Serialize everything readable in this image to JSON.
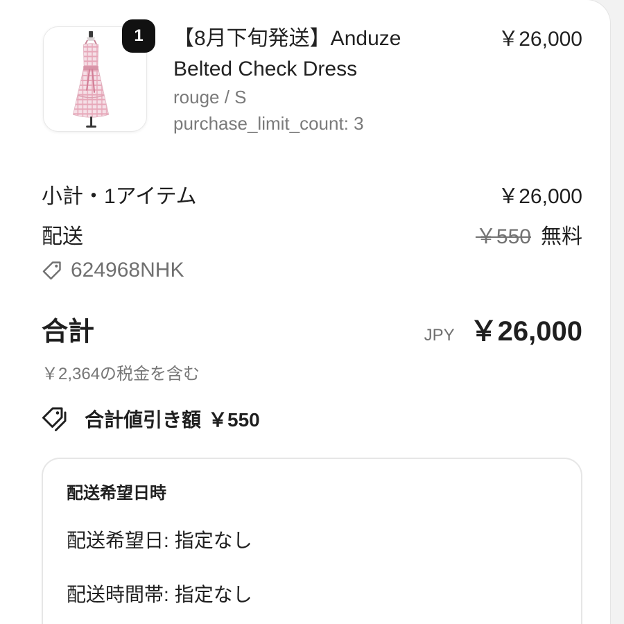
{
  "order_summary": {
    "line_item": {
      "quantity_badge": "1",
      "title": "【8月下旬発送】Anduze Belted Check Dress",
      "variant": "rouge / S",
      "property": "purchase_limit_count: 3",
      "price": "￥26,000"
    },
    "subtotal": {
      "label": "小計・1アイテム",
      "value": "￥26,000"
    },
    "shipping": {
      "label": "配送",
      "original_price": "￥550",
      "value": "無料"
    },
    "discount_code": {
      "icon": "tag-icon",
      "code": "624968NHK"
    },
    "total": {
      "label": "合計",
      "currency": "JPY",
      "value": "￥26,000"
    },
    "tax_note": "￥2,364の税金を含む",
    "total_savings": {
      "icon": "tags-icon",
      "label": "合計値引き額",
      "value": "￥550"
    }
  },
  "delivery_preferences": {
    "heading": "配送希望日時",
    "date": {
      "label": "配送希望日:",
      "value": "指定なし"
    },
    "time_slot": {
      "label": "配送時間帯:",
      "value": "指定なし"
    }
  },
  "colors": {
    "text": "#1f1f1f",
    "muted_text": "#737373",
    "border": "#e4e4e4",
    "badge": "#111111",
    "page_background": "#f2f2f2"
  }
}
